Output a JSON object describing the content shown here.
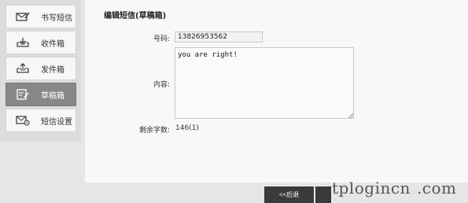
{
  "sidebar": {
    "items": [
      {
        "label": "书写短信",
        "icon": "compose-icon",
        "active": false
      },
      {
        "label": "收件箱",
        "icon": "inbox-icon",
        "active": false
      },
      {
        "label": "发件箱",
        "icon": "outbox-icon",
        "active": false
      },
      {
        "label": "草稿箱",
        "icon": "drafts-icon",
        "active": true
      },
      {
        "label": "短信设置",
        "icon": "sms-settings-icon",
        "active": false
      }
    ]
  },
  "main": {
    "title": "编辑短信(草稿箱)",
    "phone_label": "号码:",
    "phone_value": "13826953562",
    "content_label": "内容:",
    "content_value": "you are right!",
    "remaining_label": "剩余字数:",
    "remaining_value": "146(1)"
  },
  "footer": {
    "back_label": "<<后退"
  },
  "watermark": {
    "text_a": "tplogincn",
    "text_b": ".com"
  },
  "colors": {
    "active_bg": "#888888",
    "button_bg": "#3a3a3a",
    "panel_bg": "#f8f8f8",
    "page_bg": "#e6e6e6"
  }
}
